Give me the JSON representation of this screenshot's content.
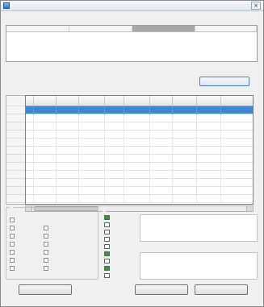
{
  "window": {
    "title": "",
    "close_glyph": "×",
    "subtitle": ""
  },
  "summary": {
    "headers": [
      "",
      "",
      "",
      ""
    ],
    "highlight_color": "#a8a8a8",
    "rows": [
      {
        "label": "",
        "values": [
          "",
          "",
          ""
        ]
      },
      {
        "label": "",
        "values": [
          "",
          "",
          ""
        ]
      },
      {
        "label": "",
        "values": [
          "",
          "",
          ""
        ]
      }
    ]
  },
  "status": {
    "label": "",
    "value": ""
  },
  "action_button": {
    "label": ""
  },
  "grid": {
    "caption": "",
    "selected_row_color": "#3d87d6",
    "columns": [
      "",
      "",
      "",
      "",
      "",
      "",
      "",
      "",
      ""
    ],
    "row_headers": [
      "",
      "",
      "",
      "",
      "",
      "",
      "",
      "",
      "",
      "",
      "",
      "",
      ""
    ],
    "rows": [
      [
        "",
        "",
        "",
        "",
        "",
        "",
        "",
        "",
        ""
      ],
      [
        "",
        "",
        "",
        "",
        "",
        "",
        "",
        "",
        ""
      ],
      [
        "",
        "",
        "",
        "",
        "",
        "",
        "",
        "",
        ""
      ],
      [
        "",
        "",
        "",
        "",
        "",
        "",
        "",
        "",
        ""
      ],
      [
        "",
        "",
        "",
        "",
        "",
        "",
        "",
        "",
        ""
      ],
      [
        "",
        "",
        "",
        "",
        "",
        "",
        "",
        "",
        ""
      ],
      [
        "",
        "",
        "",
        "",
        "",
        "",
        "",
        "",
        ""
      ],
      [
        "",
        "",
        "",
        "",
        "",
        "",
        "",
        "",
        ""
      ],
      [
        "",
        "",
        "",
        "",
        "",
        "",
        "",
        "",
        ""
      ],
      [
        "",
        "",
        "",
        "",
        "",
        "",
        "",
        "",
        ""
      ],
      [
        "",
        "",
        "",
        "",
        "",
        "",
        "",
        "",
        ""
      ],
      [
        "",
        "",
        "",
        "",
        "",
        "",
        "",
        "",
        ""
      ]
    ]
  },
  "filters": {
    "title": "",
    "left_column": [
      "",
      "",
      "",
      "",
      "",
      "",
      ""
    ],
    "right_column": [
      "",
      "",
      "",
      "",
      "",
      ""
    ]
  },
  "legend": {
    "title": "",
    "items": [
      {
        "label": "",
        "color": "#3f8f3f"
      },
      {
        "label": "",
        "color": "#ffffff"
      },
      {
        "label": "",
        "color": "#ffffff"
      },
      {
        "label": "",
        "color": "#ffffff"
      },
      {
        "label": "",
        "color": "#ffffff"
      },
      {
        "label": "",
        "color": "#3f8f3f"
      },
      {
        "label": "",
        "color": "#ffffff"
      },
      {
        "label": "",
        "color": "#3f8f3f"
      },
      {
        "label": "",
        "color": "#ffffff"
      }
    ]
  },
  "info1": {
    "title": "",
    "body": ""
  },
  "info2": {
    "title": "",
    "body": ""
  },
  "buttons": {
    "left": "",
    "middle": "",
    "right": ""
  }
}
